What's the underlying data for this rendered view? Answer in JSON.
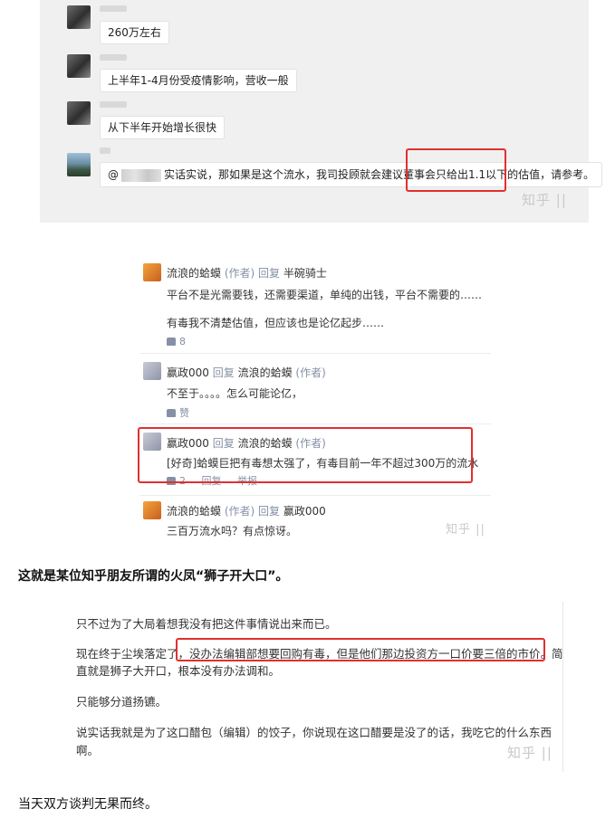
{
  "chat": {
    "messages": [
      {
        "text": "260万左右"
      },
      {
        "text": "上半年1-4月份受疫情影响，营收一般"
      },
      {
        "text": "从下半年开始增长很快"
      },
      {
        "prefix": "@",
        "text": "实话实说，那如果是这个流水，我司投顾就会建议董事会只给出1.1以下的估值，请参考。"
      }
    ],
    "watermark": "知乎 ||"
  },
  "comments": {
    "items": [
      {
        "user": "流浪的蛤蟆",
        "role": "(作者)",
        "reply": "回复",
        "target": "半碗骑士",
        "lines": [
          "平台不是光需要钱，还需要渠道，单纯的出钱，平台不需要的……",
          "有毒我不清楚估值，但应该也是论亿起步……"
        ],
        "likes": "8"
      },
      {
        "user": "赢政000",
        "reply": "回复",
        "target": "流浪的蛤蟆",
        "target_role": "(作者)",
        "lines": [
          "不至于。。。。怎么可能论亿，"
        ],
        "likes": "赞"
      },
      {
        "user": "赢政000",
        "reply": "回复",
        "target": "流浪的蛤蟆",
        "target_role": "(作者)",
        "lines": [
          "[好奇]蛤蟆巨把有毒想太强了，有毒目前一年不超过300万的流水"
        ],
        "likes": "2",
        "actions": [
          "回复",
          "举报"
        ]
      },
      {
        "user": "流浪的蛤蟆",
        "role": "(作者)",
        "reply": "回复",
        "target": "赢政000",
        "lines": [
          "三百万流水吗？有点惊讶。"
        ]
      }
    ],
    "watermark": "知乎 ||"
  },
  "article": {
    "para1": "这就是某位知乎朋友所谓的火凤“狮子开大口”。",
    "para2": "当天双方谈判无果而终。"
  },
  "post": {
    "lines": [
      "只不过为了大局着想我没有把这件事情说出来而已。",
      "现在终于尘埃落定了，没办法编辑部想要回购有毒，但是他们那边投资方一口价要三倍的市价。简",
      "直就是狮子大开口，根本没有办法调和。",
      "只能够分道扬镳。",
      "说实话我就是为了这口醋包（编辑）的饺子，你说现在这口醋要是没了的话，我吃它的什么东西",
      "啊。"
    ],
    "watermark": "知乎 ||"
  },
  "colors": {
    "highlight": "#e0302f",
    "meta": "#8590a6",
    "chat_bg": "#f0f0f0"
  }
}
